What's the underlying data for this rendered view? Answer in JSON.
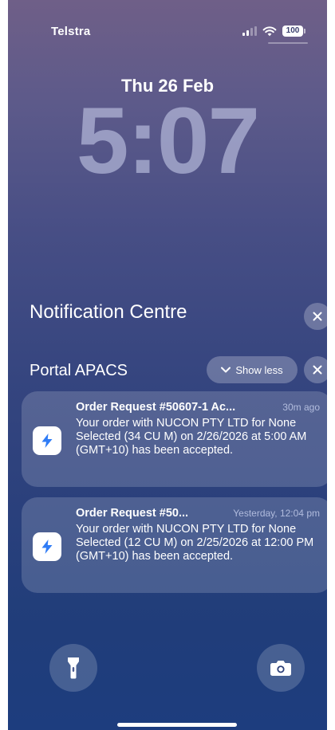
{
  "status_bar": {
    "carrier": "Telstra",
    "battery": "100",
    "icons": [
      "signal-icon",
      "wifi-icon",
      "battery-icon"
    ]
  },
  "lock_screen": {
    "date": "Thu 26 Feb",
    "time": "5:07"
  },
  "notification_centre": {
    "title": "Notification Centre",
    "close_icon": "close-icon"
  },
  "app_group": {
    "app_name": "Portal APACS",
    "show_less_label": "Show less",
    "close_icon": "close-icon",
    "notifications": [
      {
        "title": "Order Request #50607-1 Ac...",
        "time": "30m ago",
        "body": "Your order with NUCON PTY LTD for None Selected (34 CU M) on 2/26/2026 at 5:00 AM (GMT+10) has been accepted.",
        "icon": "lightning-app-icon"
      },
      {
        "title": "Order Request #50...",
        "time": "Yesterday, 12:04 pm",
        "body": "Your order with NUCON PTY LTD for None Selected (12 CU M) on 2/25/2026 at 12:00 PM (GMT+10) has been accepted.",
        "icon": "lightning-app-icon"
      }
    ]
  },
  "controls": {
    "left": "flashlight-icon",
    "right": "camera-icon"
  },
  "colors": {
    "app_icon_blue": "#2f7cf6",
    "background_top": "#6f5f88",
    "background_bottom": "#1d3d7e"
  }
}
